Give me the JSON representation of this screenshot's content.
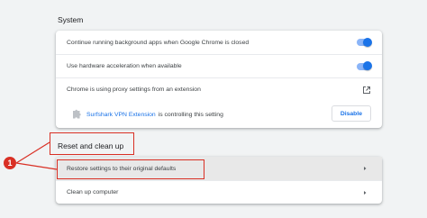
{
  "system": {
    "title": "System",
    "rows": [
      {
        "label": "Continue running background apps when Google Chrome is closed",
        "control": "toggle",
        "checked": true
      },
      {
        "label": "Use hardware acceleration when available",
        "control": "toggle",
        "checked": true
      },
      {
        "label": "Chrome is using proxy settings from an extension",
        "control": "external-link-icon"
      }
    ],
    "extension": {
      "name": "Surfshark VPN Extension",
      "suffix": "is controlling this setting",
      "button": "Disable"
    }
  },
  "reset": {
    "title": "Reset and clean up",
    "rows": [
      {
        "label": "Restore settings to their original defaults"
      },
      {
        "label": "Clean up computer"
      }
    ]
  },
  "annotation": {
    "badge": "1",
    "color": "#d93025"
  },
  "colors": {
    "accent": "#1a73e8",
    "background": "#f1f3f4"
  }
}
